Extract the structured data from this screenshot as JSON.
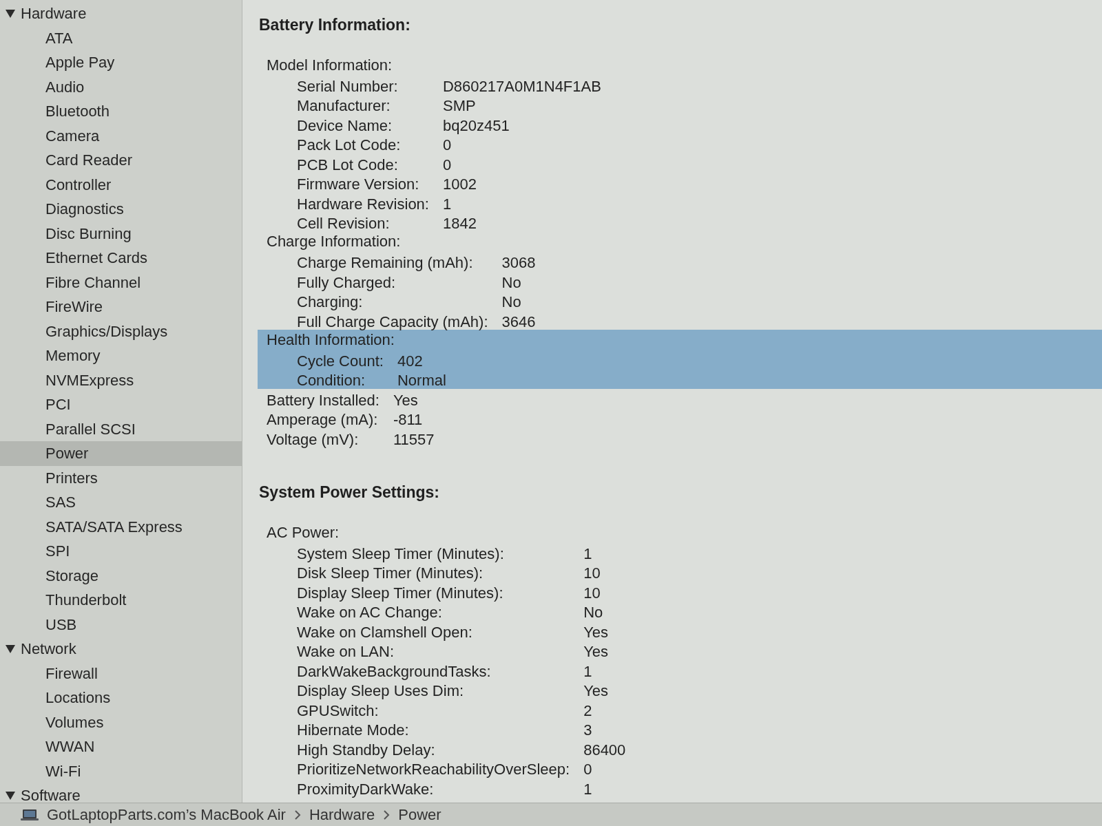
{
  "sidebar": {
    "sections": [
      {
        "label": "Hardware",
        "expanded": true,
        "selected": false,
        "children": [
          {
            "label": "ATA",
            "selected": false
          },
          {
            "label": "Apple Pay",
            "selected": false
          },
          {
            "label": "Audio",
            "selected": false
          },
          {
            "label": "Bluetooth",
            "selected": false
          },
          {
            "label": "Camera",
            "selected": false
          },
          {
            "label": "Card Reader",
            "selected": false
          },
          {
            "label": "Controller",
            "selected": false
          },
          {
            "label": "Diagnostics",
            "selected": false
          },
          {
            "label": "Disc Burning",
            "selected": false
          },
          {
            "label": "Ethernet Cards",
            "selected": false
          },
          {
            "label": "Fibre Channel",
            "selected": false
          },
          {
            "label": "FireWire",
            "selected": false
          },
          {
            "label": "Graphics/Displays",
            "selected": false
          },
          {
            "label": "Memory",
            "selected": false
          },
          {
            "label": "NVMExpress",
            "selected": false
          },
          {
            "label": "PCI",
            "selected": false
          },
          {
            "label": "Parallel SCSI",
            "selected": false
          },
          {
            "label": "Power",
            "selected": true
          },
          {
            "label": "Printers",
            "selected": false
          },
          {
            "label": "SAS",
            "selected": false
          },
          {
            "label": "SATA/SATA Express",
            "selected": false
          },
          {
            "label": "SPI",
            "selected": false
          },
          {
            "label": "Storage",
            "selected": false
          },
          {
            "label": "Thunderbolt",
            "selected": false
          },
          {
            "label": "USB",
            "selected": false
          }
        ]
      },
      {
        "label": "Network",
        "expanded": true,
        "selected": false,
        "children": [
          {
            "label": "Firewall",
            "selected": false
          },
          {
            "label": "Locations",
            "selected": false
          },
          {
            "label": "Volumes",
            "selected": false
          },
          {
            "label": "WWAN",
            "selected": false
          },
          {
            "label": "Wi-Fi",
            "selected": false
          }
        ]
      },
      {
        "label": "Software",
        "expanded": true,
        "selected": false
      }
    ]
  },
  "report": {
    "sections": [
      {
        "title": "Battery Information:",
        "items": [
          {
            "label": "Model Information:",
            "selected": false,
            "children": [
              {
                "label": "Serial Number:",
                "value": "D860217A0M1N4F1AB"
              },
              {
                "label": "Manufacturer:",
                "value": "SMP"
              },
              {
                "label": "Device Name:",
                "value": "bq20z451"
              },
              {
                "label": "Pack Lot Code:",
                "value": "0"
              },
              {
                "label": "PCB Lot Code:",
                "value": "0"
              },
              {
                "label": "Firmware Version:",
                "value": "1002"
              },
              {
                "label": "Hardware Revision:",
                "value": "1"
              },
              {
                "label": "Cell Revision:",
                "value": "1842"
              }
            ]
          },
          {
            "label": "Charge Information:",
            "selected": false,
            "children": [
              {
                "label": "Charge Remaining (mAh):",
                "value": "3068"
              },
              {
                "label": "Fully Charged:",
                "value": "No"
              },
              {
                "label": "Charging:",
                "value": "No"
              },
              {
                "label": "Full Charge Capacity (mAh):",
                "value": "3646"
              }
            ]
          },
          {
            "label": "Health Information:",
            "selected": true,
            "children": [
              {
                "label": "Cycle Count:",
                "value": "402"
              },
              {
                "label": "Condition:",
                "value": "Normal"
              }
            ]
          },
          {
            "label": "Battery Installed:",
            "value": "Yes",
            "selected": false
          },
          {
            "label": "Amperage (mA):",
            "value": "-811",
            "selected": false
          },
          {
            "label": "Voltage (mV):",
            "value": "11557",
            "selected": false
          }
        ]
      },
      {
        "title": "System Power Settings:",
        "items": [
          {
            "label": "AC Power:",
            "selected": false,
            "children": [
              {
                "label": "System Sleep Timer (Minutes):",
                "value": "1"
              },
              {
                "label": "Disk Sleep Timer (Minutes):",
                "value": "10"
              },
              {
                "label": "Display Sleep Timer (Minutes):",
                "value": "10"
              },
              {
                "label": "Wake on AC Change:",
                "value": "No"
              },
              {
                "label": "Wake on Clamshell Open:",
                "value": "Yes"
              },
              {
                "label": "Wake on LAN:",
                "value": "Yes"
              },
              {
                "label": "DarkWakeBackgroundTasks:",
                "value": "1"
              },
              {
                "label": "Display Sleep Uses Dim:",
                "value": "Yes"
              },
              {
                "label": "GPUSwitch:",
                "value": "2"
              },
              {
                "label": "Hibernate Mode:",
                "value": "3"
              },
              {
                "label": "High Standby Delay:",
                "value": "86400"
              },
              {
                "label": "PrioritizeNetworkReachabilityOverSleep:",
                "value": "0"
              },
              {
                "label": "ProximityDarkWake:",
                "value": "1"
              }
            ]
          }
        ]
      }
    ]
  },
  "status_bar": {
    "path": [
      "GotLaptopParts.com’s MacBook Air",
      "Hardware",
      "Power"
    ]
  }
}
